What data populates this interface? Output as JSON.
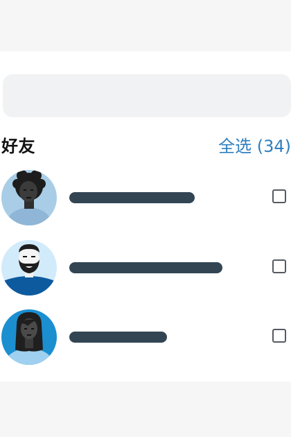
{
  "section": {
    "title": "好友",
    "select_all_label": "全选 (34)"
  },
  "friends": [
    {
      "avatar": "person-curly-hair-avatar-icon",
      "name_bar_fraction": 0.43,
      "checked": false
    },
    {
      "avatar": "person-bearded-avatar-icon",
      "name_bar_fraction": 0.53,
      "checked": false
    },
    {
      "avatar": "person-long-hair-avatar-icon",
      "name_bar_fraction": 0.34,
      "checked": false
    }
  ],
  "colors": {
    "background": "#f6f6f7",
    "card": "#ffffff",
    "search_bar": "#f1f2f4",
    "accent": "#2f7fbf",
    "name_placeholder": "#334553"
  }
}
